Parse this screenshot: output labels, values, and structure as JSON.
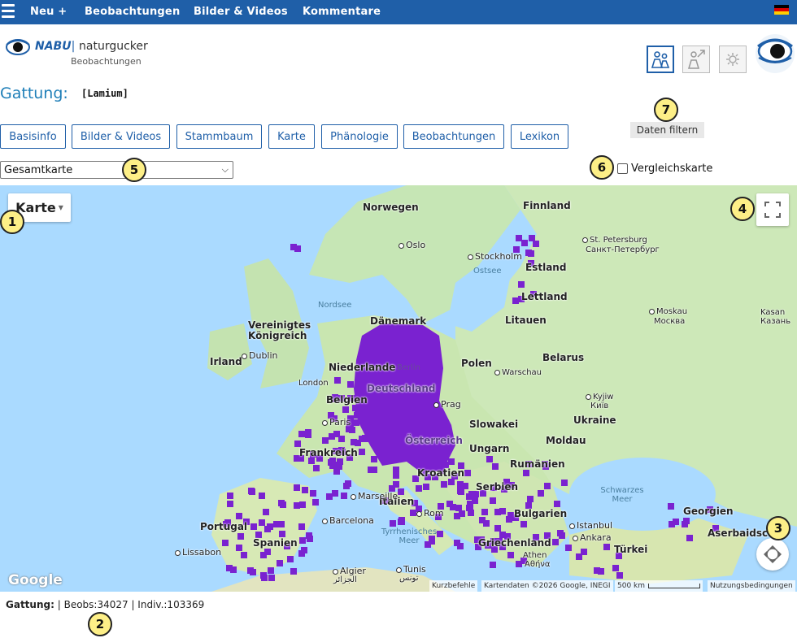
{
  "topnav": {
    "items": [
      "Neu +",
      "Beobachtungen",
      "Bilder & Videos",
      "Kommentare"
    ]
  },
  "logo": {
    "brand": "NABU",
    "name": "naturgucker",
    "subtitle": "Beobachtungen"
  },
  "page": {
    "title": "Gattung:",
    "genus": "[Lamium]"
  },
  "tabs": [
    "Basisinfo",
    "Bilder & Videos",
    "Stammbaum",
    "Karte",
    "Phänologie",
    "Beobachtungen",
    "Lexikon"
  ],
  "filter_button": "Daten filtern",
  "map_select": {
    "selected": "Gesamtkarte"
  },
  "compare_label": "Vergleichskarte",
  "map": {
    "type_button": "Karte",
    "labels": {
      "countries": [
        "Norwegen",
        "Finnland",
        "Estland",
        "Lettland",
        "Litauen",
        "Dänemark",
        "Vereinigtes Königreich",
        "Irland",
        "Niederlande",
        "Polen",
        "Belarus",
        "Deutschland",
        "Belgien",
        "Ukraine",
        "Slowakei",
        "Moldau",
        "Frankreich",
        "Österreich",
        "Ungarn",
        "Rumänien",
        "Kroatien",
        "Serbien",
        "Italien",
        "Bulgarien",
        "Portugal",
        "Spanien",
        "Griechenland",
        "Türkei",
        "Georgien",
        "Aserbaidschan",
        "Moskau",
        "Москва",
        "Kasan",
        "Казань"
      ],
      "seas": [
        "Nordsee",
        "Ostsee",
        "Schwarzes Meer",
        "Tyrrhenisches Meer"
      ],
      "cities": [
        "Oslo",
        "Stockholm",
        "St. Petersburg",
        "Санкт-Петербург",
        "Dublin",
        "Warschau",
        "Berlin",
        "Prag",
        "Paris",
        "Kyjiw",
        "Київ",
        "Marseille",
        "Barcelona",
        "Rom",
        "Istanbul",
        "Ankara",
        "Lissabon",
        "Algier",
        "الجزائر",
        "Tunis",
        "تونس",
        "Athen",
        "Αθήνα",
        "London"
      ]
    },
    "attribution": {
      "shortcuts": "Kurzbefehle",
      "data": "Kartendaten ©2026 Google, INEGI",
      "scale": "500 km",
      "terms": "Nutzungsbedingungen"
    },
    "google": "Google",
    "observation_color": "#7a22d0"
  },
  "stats": {
    "label": "Gattung:",
    "text": "| Beobs:34027 | Indiv.:103369"
  },
  "badges": [
    "1",
    "2",
    "3",
    "4",
    "5",
    "6",
    "7"
  ],
  "colors": {
    "accent": "#1f5fa8",
    "badge": "#fdef87"
  }
}
